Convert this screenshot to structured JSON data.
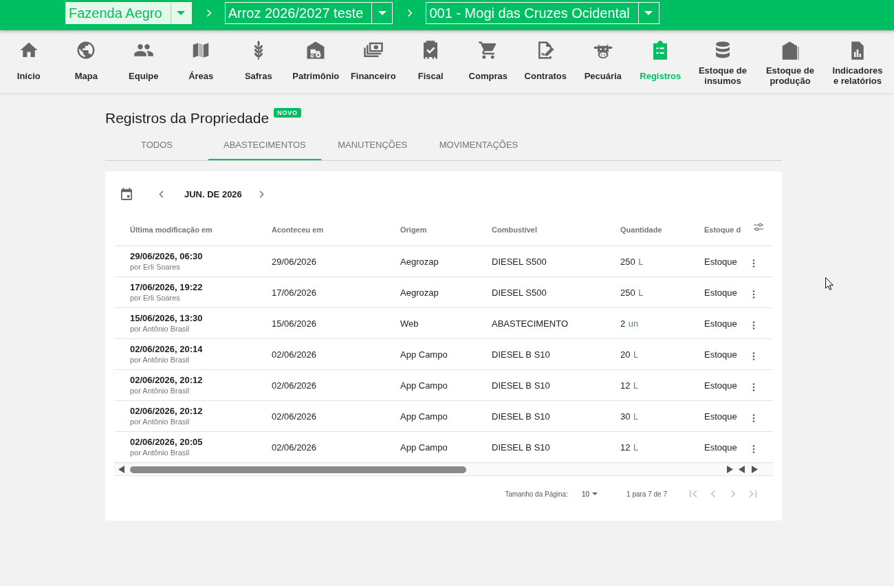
{
  "top_bar": {
    "selectors": [
      {
        "value": "Fazenda Aegro",
        "focused": true
      },
      {
        "value": "Arroz 2026/2027 teste",
        "focused": false
      },
      {
        "value": "001 - Mogi das Cruzes Ocidental",
        "focused": false
      }
    ]
  },
  "nav": [
    {
      "label": "Início",
      "selected": false
    },
    {
      "label": "Mapa",
      "selected": false
    },
    {
      "label": "Equipe",
      "selected": false
    },
    {
      "label": "Áreas",
      "selected": false
    },
    {
      "label": "Safras",
      "selected": false
    },
    {
      "label": "Patrimônio",
      "selected": false
    },
    {
      "label": "Financeiro",
      "selected": false
    },
    {
      "label": "Fiscal",
      "selected": false
    },
    {
      "label": "Compras",
      "selected": false
    },
    {
      "label": "Contratos",
      "selected": false
    },
    {
      "label": "Pecuária",
      "selected": false
    },
    {
      "label": "Registros",
      "selected": true
    },
    {
      "label": "Estoque de insumos",
      "selected": false
    },
    {
      "label": "Estoque de produção",
      "selected": false
    },
    {
      "label": "Indicadores e relatórios",
      "selected": false
    }
  ],
  "page": {
    "title": "Registros da Propriedade",
    "badge": "NOVO"
  },
  "tabs": [
    {
      "label": "TODOS",
      "selected": false
    },
    {
      "label": "ABASTECIMENTOS",
      "selected": true
    },
    {
      "label": "MANUTENÇÕES",
      "selected": false
    },
    {
      "label": "MOVIMENTAÇÕES",
      "selected": false
    }
  ],
  "records": {
    "month": "JUN. DE 2026",
    "table": {
      "columns": [
        "Última modificação em",
        "Aconteceu em",
        "Origem",
        "Combustível",
        "Quantidade",
        "Estoque d"
      ],
      "rows": [
        {
          "modified": "29/06/2026, 06:30",
          "author": "por Erli Soares",
          "happened": "29/06/2026",
          "origin": "Aegrozap",
          "fuel": "DIESEL S500",
          "quantity": "250",
          "unit": "L",
          "stock": "Estoque"
        },
        {
          "modified": "17/06/2026, 19:22",
          "author": "por Erli Soares",
          "happened": "17/06/2026",
          "origin": "Aegrozap",
          "fuel": "DIESEL S500",
          "quantity": "250",
          "unit": "L",
          "stock": "Estoque"
        },
        {
          "modified": "15/06/2026, 13:30",
          "author": "por Antônio Brasil",
          "happened": "15/06/2026",
          "origin": "Web",
          "fuel": "ABASTECIMENTO",
          "quantity": "2",
          "unit": "un",
          "stock": "Estoque"
        },
        {
          "modified": "02/06/2026, 20:14",
          "author": "por Antônio Brasil",
          "happened": "02/06/2026",
          "origin": "App Campo",
          "fuel": "DIESEL B S10",
          "quantity": "20",
          "unit": "L",
          "stock": "Estoque"
        },
        {
          "modified": "02/06/2026, 20:12",
          "author": "por Antônio Brasil",
          "happened": "02/06/2026",
          "origin": "App Campo",
          "fuel": "DIESEL B S10",
          "quantity": "12",
          "unit": "L",
          "stock": "Estoque"
        },
        {
          "modified": "02/06/2026, 20:12",
          "author": "por Antônio Brasil",
          "happened": "02/06/2026",
          "origin": "App Campo",
          "fuel": "DIESEL B S10",
          "quantity": "30",
          "unit": "L",
          "stock": "Estoque"
        },
        {
          "modified": "02/06/2026, 20:05",
          "author": "por Antônio Brasil",
          "happened": "02/06/2026",
          "origin": "App Campo",
          "fuel": "DIESEL B S10",
          "quantity": "12",
          "unit": "L",
          "stock": "Estoque"
        }
      ]
    },
    "pagination": {
      "page_size_label": "Tamanho da Página:",
      "page_size": "10",
      "range": "1 para 7 de 7",
      "buttons": [
        {
          "disabled": true
        },
        {
          "disabled": true
        },
        {
          "disabled": true
        },
        {
          "disabled": true
        }
      ]
    }
  }
}
